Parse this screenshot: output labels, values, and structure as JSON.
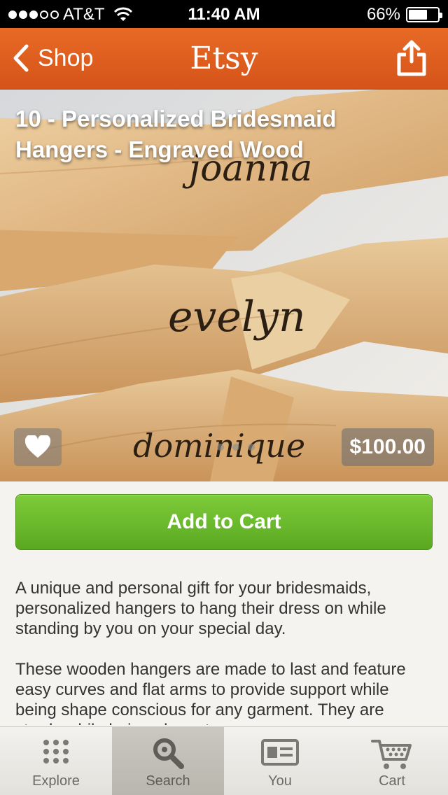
{
  "status_bar": {
    "carrier": "AT&T",
    "time": "11:40 AM",
    "battery_percent": "66%",
    "battery_level": 0.66,
    "signal_bars_filled": 3,
    "signal_bars_total": 5
  },
  "nav": {
    "back_label": "Shop",
    "title": "Etsy",
    "back_icon": "chevron-left-icon",
    "share_icon": "share-icon"
  },
  "listing": {
    "title": "10 - Personalized Bridesmaid Hangers - Engraved Wood",
    "price": "$100.00",
    "favorite_icon": "heart-icon",
    "image_count": 3,
    "image_names": [
      "joanna",
      "evelyn",
      "dominique"
    ],
    "add_to_cart_label": "Add to Cart",
    "description": [
      "A unique and personal gift for your bridesmaids, personalized hangers to hang their dress on while standing by you on your special day.",
      "These wooden hangers are made to last and feature easy curves and flat arms to provide support while being shape conscious for any garment. They are sturdy while being elegant."
    ]
  },
  "tabs": [
    {
      "label": "Explore",
      "icon": "grid-dots-icon",
      "active": false
    },
    {
      "label": "Search",
      "icon": "magnifier-icon",
      "active": true
    },
    {
      "label": "You",
      "icon": "profile-card-icon",
      "active": false
    },
    {
      "label": "Cart",
      "icon": "shopping-cart-icon",
      "active": false
    }
  ],
  "colors": {
    "nav_orange": "#e0601f",
    "cart_green": "#6bbb2c",
    "tab_active": "#c1bfb6"
  }
}
